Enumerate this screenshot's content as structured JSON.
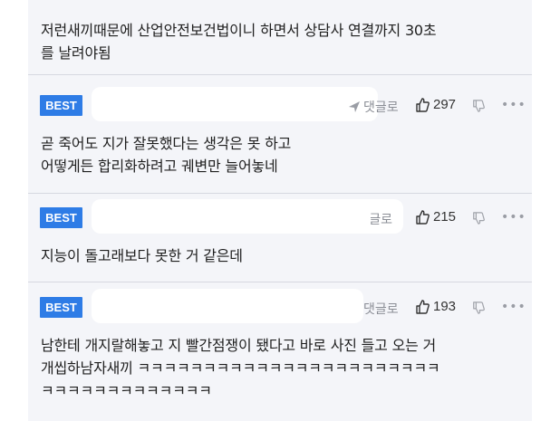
{
  "comments": [
    {
      "text": "저런새끼때문에 산업안전보건법이니 하면서 상담사 연결까지 30초\n를 날려야됨"
    },
    {
      "badge": "BEST",
      "reply_label": "댓글로",
      "likes": "297",
      "text": "곧 죽어도 지가 잘못했다는 생각은 못 하고\n어떻게든 합리화하려고 궤변만 늘어놓네"
    },
    {
      "badge": "BEST",
      "reply_label": "댓글로",
      "likes": "215",
      "text": "지능이 돌고래보다 못한 거 같은데"
    },
    {
      "badge": "BEST",
      "reply_label": "댓글로",
      "likes": "193",
      "text": "남한테 개지랄해놓고 지 빨간점쟁이 됐다고 바로 사진 들고 오는 거\n개씹하남자새끼 ㅋㅋㅋㅋㅋㅋㅋㅋㅋㅋㅋㅋㅋㅋㅋㅋㅋㅋㅋㅋㅋㅋㅋ\nㅋㅋㅋㅋㅋㅋㅋㅋㅋㅋㅋㅋㅋ"
    }
  ],
  "icons": {
    "reply": "send-arrow-icon",
    "like": "thumbs-up-icon",
    "dislike": "thumbs-down-icon",
    "more": "more-dots-icon"
  },
  "colors": {
    "badge": "#2e7ce6",
    "panel": "#f4f5f9"
  }
}
